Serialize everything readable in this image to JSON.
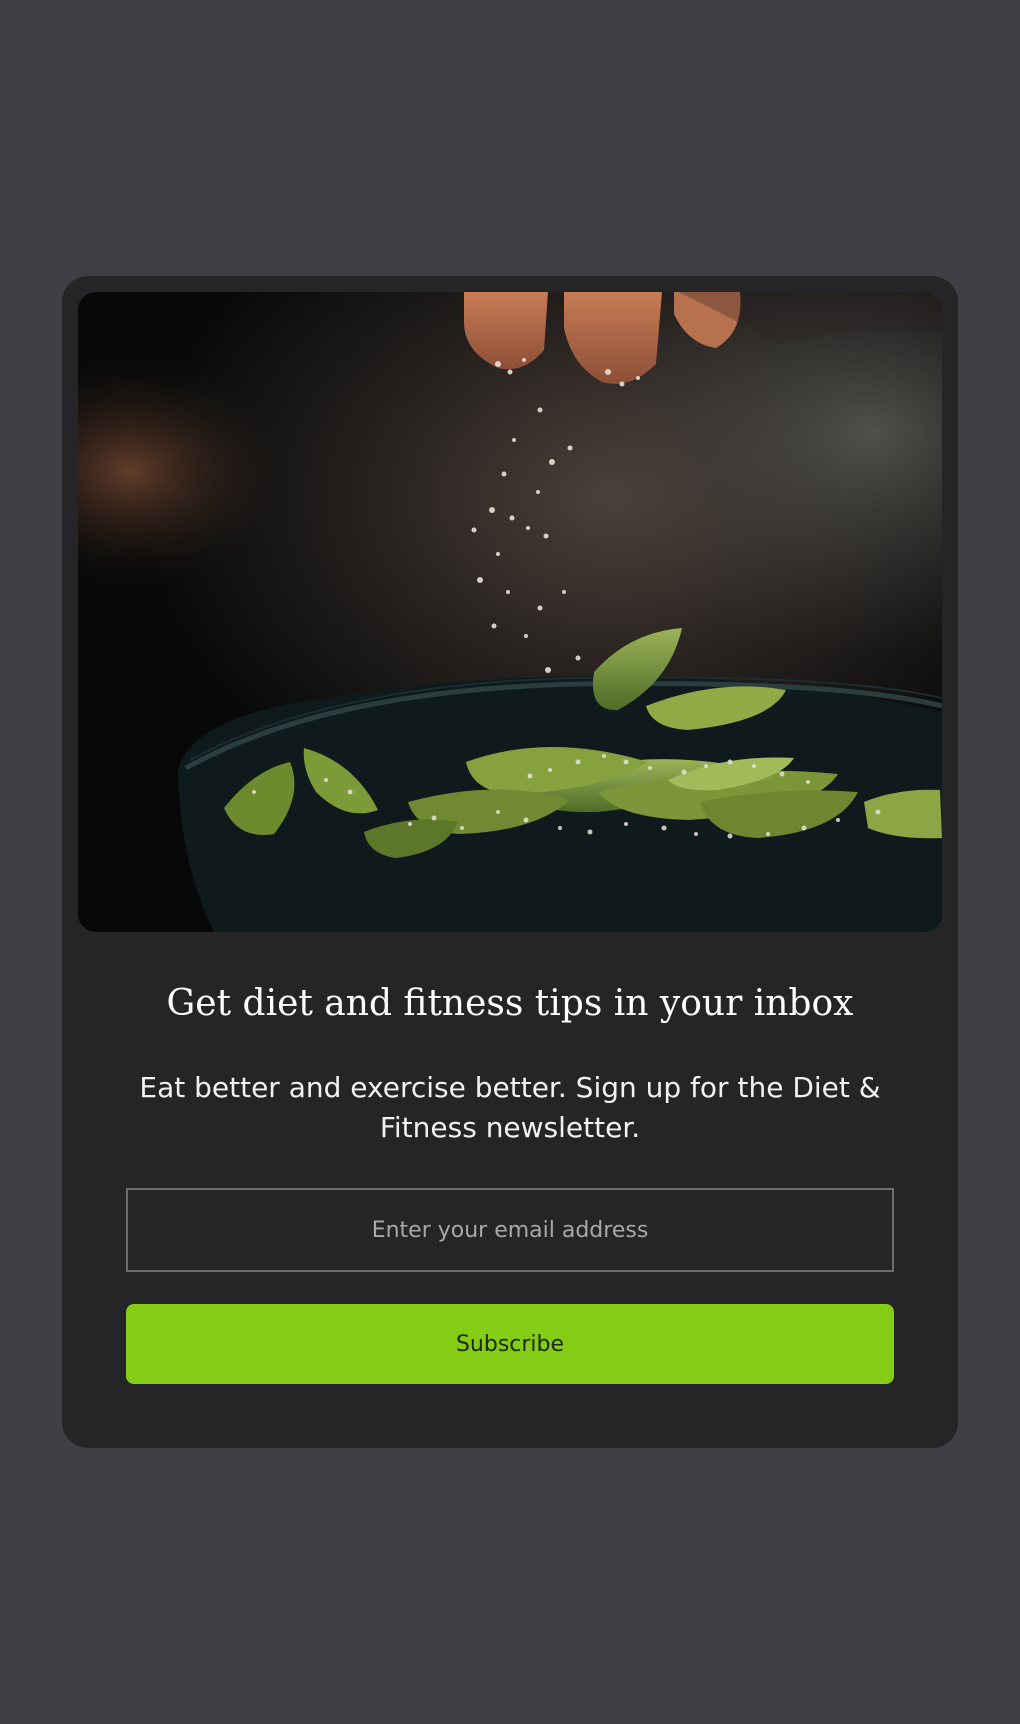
{
  "newsletter": {
    "title": "Get diet and fitness tips in your inbox",
    "description": "Eat better and exercise better. Sign up for the Diet & Fitness newsletter.",
    "email_placeholder": "Enter your email address",
    "email_value": "",
    "subscribe_label": "Subscribe",
    "accent_color": "#84cc16",
    "background_color": "#3f4045",
    "card_color": "#252527"
  }
}
